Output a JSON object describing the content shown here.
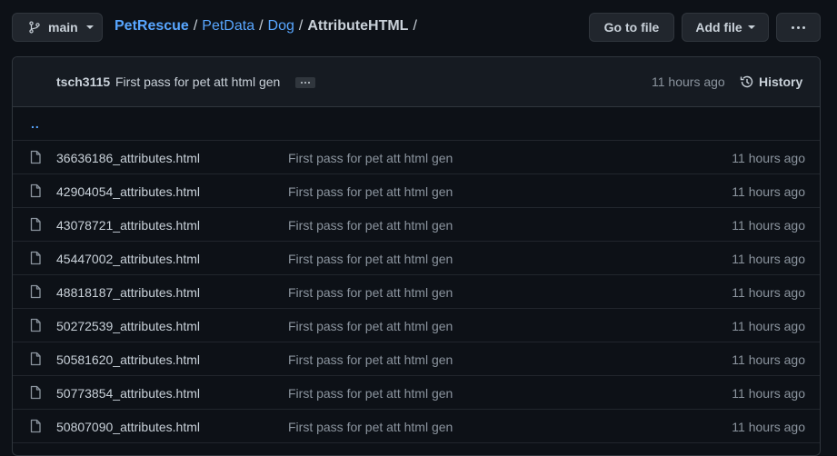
{
  "branch": {
    "name": "main"
  },
  "breadcrumb": {
    "repo": "PetRescue",
    "parts": [
      "PetData",
      "Dog"
    ],
    "current": "AttributeHTML",
    "separator": "/"
  },
  "toolbar": {
    "goto_label": "Go to file",
    "add_label": "Add file"
  },
  "commit": {
    "author": "tsch3115",
    "message": "First pass for pet att html gen",
    "time": "11 hours ago",
    "history_label": "History"
  },
  "parent_dir": "..",
  "files": [
    {
      "name": "36636186_attributes.html",
      "message": "First pass for pet att html gen",
      "time": "11 hours ago"
    },
    {
      "name": "42904054_attributes.html",
      "message": "First pass for pet att html gen",
      "time": "11 hours ago"
    },
    {
      "name": "43078721_attributes.html",
      "message": "First pass for pet att html gen",
      "time": "11 hours ago"
    },
    {
      "name": "45447002_attributes.html",
      "message": "First pass for pet att html gen",
      "time": "11 hours ago"
    },
    {
      "name": "48818187_attributes.html",
      "message": "First pass for pet att html gen",
      "time": "11 hours ago"
    },
    {
      "name": "50272539_attributes.html",
      "message": "First pass for pet att html gen",
      "time": "11 hours ago"
    },
    {
      "name": "50581620_attributes.html",
      "message": "First pass for pet att html gen",
      "time": "11 hours ago"
    },
    {
      "name": "50773854_attributes.html",
      "message": "First pass for pet att html gen",
      "time": "11 hours ago"
    },
    {
      "name": "50807090_attributes.html",
      "message": "First pass for pet att html gen",
      "time": "11 hours ago"
    }
  ],
  "colors": {
    "background": "#0d1117",
    "link": "#58a6ff",
    "muted": "#8b949e",
    "text": "#c9d1d9",
    "border": "#30363d"
  }
}
